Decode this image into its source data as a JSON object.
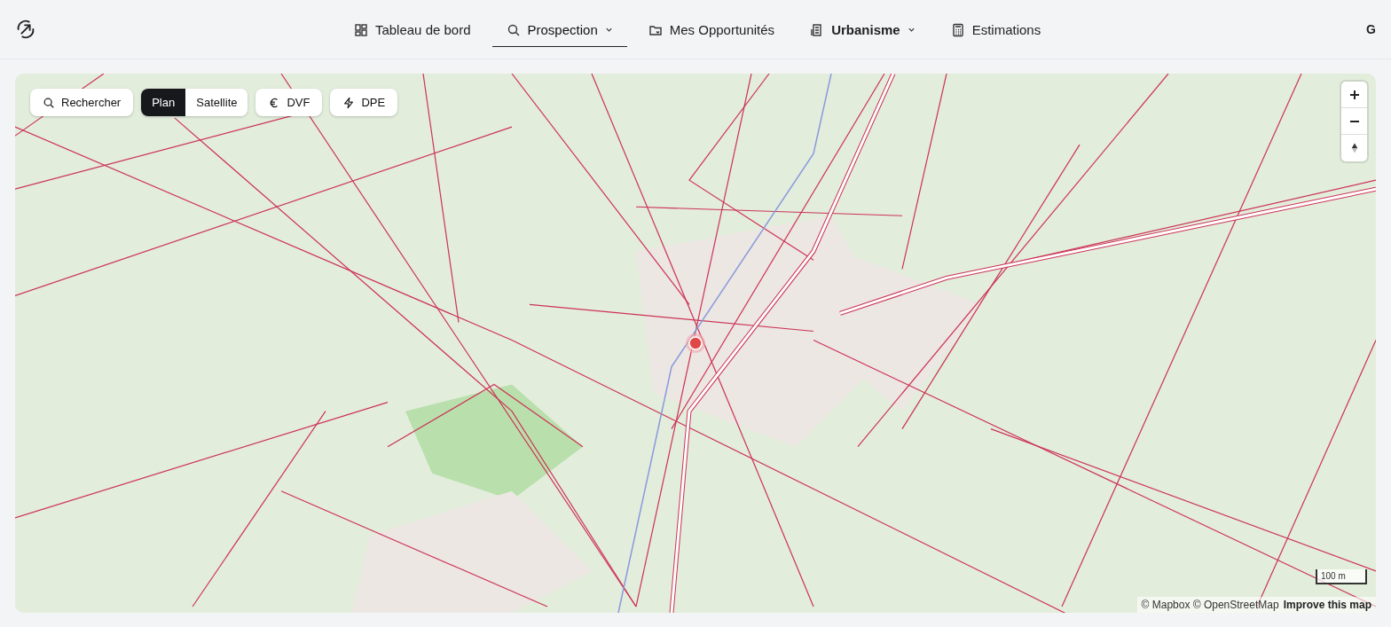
{
  "header": {
    "nav": [
      {
        "label": "Tableau de bord",
        "selected": false,
        "dropdown": false,
        "emphasized": false
      },
      {
        "label": "Prospection",
        "selected": true,
        "dropdown": true,
        "emphasized": false
      },
      {
        "label": "Mes Opportunités",
        "selected": false,
        "dropdown": false,
        "emphasized": false
      },
      {
        "label": "Urbanisme",
        "selected": false,
        "dropdown": true,
        "emphasized": true
      },
      {
        "label": "Estimations",
        "selected": false,
        "dropdown": false,
        "emphasized": false
      }
    ],
    "avatar": "G"
  },
  "map": {
    "search_button": "Rechercher",
    "view_toggle": [
      {
        "label": "Plan",
        "selected": true
      },
      {
        "label": "Satellite",
        "selected": false
      }
    ],
    "layers": [
      {
        "label": "DVF",
        "kind": "euro"
      },
      {
        "label": "DPE",
        "kind": "bolt"
      }
    ],
    "scale": "100 m",
    "attribution": "© Mapbox © OpenStreetMap",
    "improve_link": "Improve this map"
  }
}
